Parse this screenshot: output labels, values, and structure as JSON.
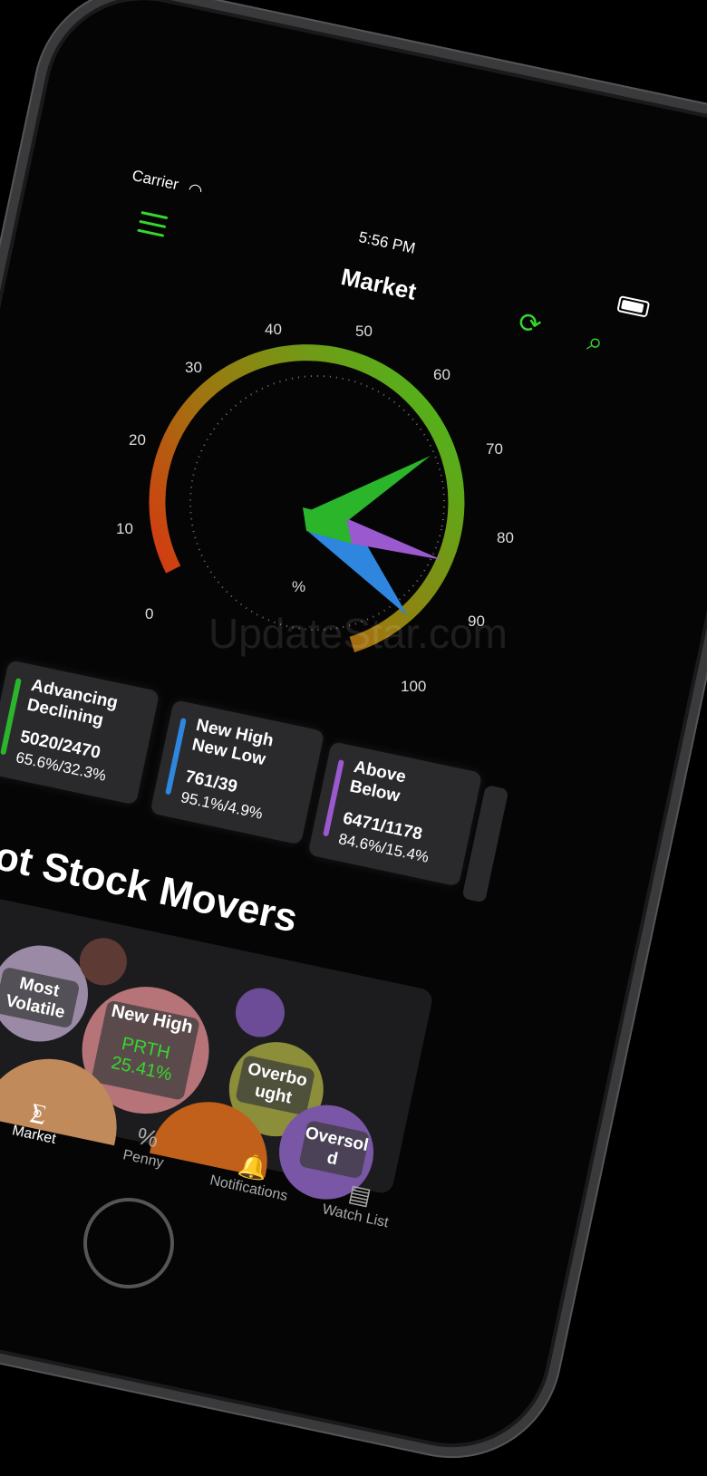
{
  "status": {
    "carrier": "Carrier",
    "time": "5:56 PM"
  },
  "header": {
    "title": "Market",
    "menu_icon": "hamburger-menu-icon",
    "refresh_icon": "refresh-icon",
    "search_icon": "search-icon"
  },
  "gauge": {
    "tick_labels": [
      "0",
      "10",
      "20",
      "30",
      "40",
      "50",
      "60",
      "70",
      "80",
      "90",
      "100"
    ],
    "unit": "%",
    "needles": [
      {
        "name": "Advancing",
        "value": 65.6,
        "color": "#2bb52b"
      },
      {
        "name": "New High",
        "value": 95.1,
        "color": "#2e86de"
      },
      {
        "name": "Above",
        "value": 84.6,
        "color": "#9b59d0"
      }
    ]
  },
  "watermark": "UpdateStar.com",
  "cards": [
    {
      "line1": "Advancing",
      "line2": "Declining",
      "value": "5020/2470",
      "pct": "65.6%/32.3%",
      "color": "#2bb52b"
    },
    {
      "line1": "New High",
      "line2": "New Low",
      "value": "761/39",
      "pct": "95.1%/4.9%",
      "color": "#2e86de"
    },
    {
      "line1": "Above",
      "line2": "Below",
      "value": "6471/1178",
      "pct": "84.6%/15.4%",
      "color": "#9b59d0"
    }
  ],
  "section_title": "ot Stock Movers",
  "bubbles": {
    "most_volatile": "Most Volatile",
    "new_high": "New High",
    "new_high_ticker": "PRTH",
    "new_high_pct": "25.41%",
    "overbought": "Overbo ught",
    "oversold": "Oversol d"
  },
  "tabs": [
    {
      "label": "Market",
      "icon": "candlestick-icon"
    },
    {
      "label": "Penny",
      "icon": "percent-tag-icon"
    },
    {
      "label": "Notifications",
      "icon": "bell-icon"
    },
    {
      "label": "Watch List",
      "icon": "watchlist-icon"
    }
  ]
}
